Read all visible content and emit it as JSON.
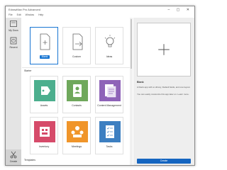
{
  "window": {
    "title": "EdrawMax Pro Advanced",
    "menu": [
      "File",
      "Edit",
      "Window",
      "Help"
    ]
  },
  "sidebar": {
    "items": [
      {
        "label": "My Docs",
        "icon": "folder-icon"
      },
      {
        "label": "Recent",
        "icon": "clock-icon"
      },
      {
        "label": "Create",
        "icon": "scissors-icon"
      }
    ]
  },
  "top_tiles": [
    {
      "label": "Blank",
      "icon": "blank-document-icon",
      "selected": true
    },
    {
      "label": "Custom",
      "icon": "custom-document-icon"
    },
    {
      "label": "Ideas",
      "icon": "lightbulb-icon"
    }
  ],
  "sections": [
    {
      "title": "Starter"
    },
    {
      "title": "Templates"
    }
  ],
  "templates": [
    {
      "label": "Assets",
      "color": "#4caf8e",
      "icon": "tag-icon"
    },
    {
      "label": "Contacts",
      "color": "#6fa85c",
      "icon": "contact-card-icon"
    },
    {
      "label": "Content Management",
      "color": "#8e63b8",
      "icon": "content-list-icon"
    },
    {
      "label": "Inventory",
      "color": "#d64b6a",
      "icon": "inventory-icon"
    },
    {
      "label": "Meetings",
      "color": "#f0952a",
      "icon": "meeting-icon"
    },
    {
      "label": "Tasks",
      "color": "#3d7fc1",
      "icon": "checklist-icon"
    }
  ],
  "right_panel": {
    "title": "Blank",
    "description_1": "A blank app with a Library, Default fields, and one layout.",
    "description_2": "You can easily customize this app later on. Learn more.",
    "create_label": "Create"
  },
  "colors": {
    "accent": "#1976d2",
    "create_button": "#1565c0",
    "sidebar_bg": "#e4e4e4",
    "right_panel_bg": "#eeeeee"
  }
}
